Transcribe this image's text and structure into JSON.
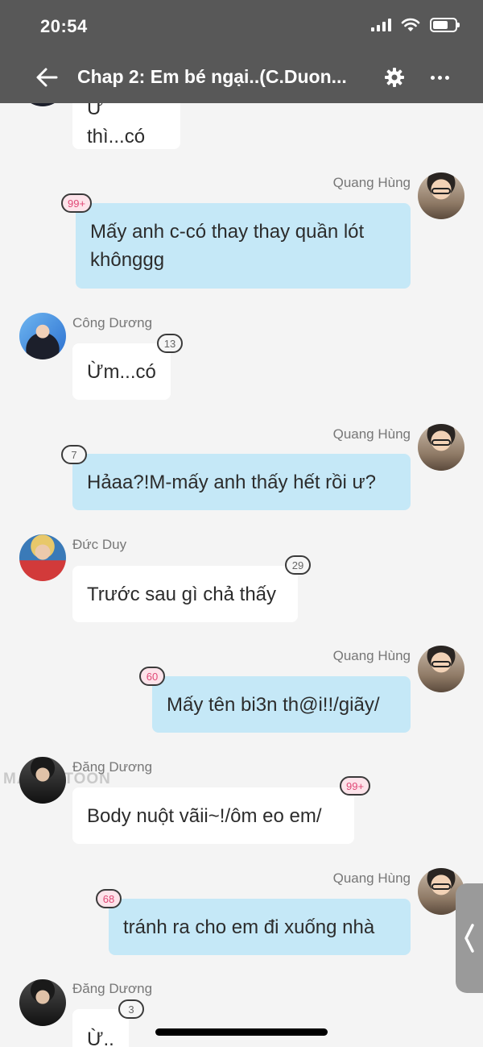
{
  "status_bar": {
    "time": "20:54"
  },
  "nav": {
    "title": "Chap 2: Em bé ngại..(C.Duon..."
  },
  "messages": [
    {
      "side": "left",
      "name": "",
      "text": "Ừ thì...có",
      "badge": ""
    },
    {
      "side": "right",
      "name": "Quang Hùng",
      "text": "Mấy anh c-có thay thay quần lót khônggg",
      "badge": "99+"
    },
    {
      "side": "left",
      "name": "Công Dương",
      "text": "Ừm...có",
      "badge": "13"
    },
    {
      "side": "right",
      "name": "Quang Hùng",
      "text": "Hảaa?!M-mấy anh thấy hết rồi ư?",
      "badge": "7"
    },
    {
      "side": "left",
      "name": "Đức Duy",
      "text": "Trước sau gì chả thấy",
      "badge": "29"
    },
    {
      "side": "right",
      "name": "Quang Hùng",
      "text": "Mấy tên bi3n th@i!!/giãy/",
      "badge": "60"
    },
    {
      "side": "left",
      "name": "Đăng Dương",
      "text": "Body nuột vãii~!/ôm eo em/",
      "badge": "99+"
    },
    {
      "side": "right",
      "name": "Quang Hùng",
      "text": "tránh ra cho em đi xuống nhà",
      "badge": "68"
    },
    {
      "side": "left",
      "name": "Đăng Dương",
      "text": "Ừ..",
      "badge": "3"
    }
  ],
  "watermark": "MANGATOON",
  "colors": {
    "header_bg": "#585858",
    "right_bubble": "#c5e8f7",
    "left_bubble": "#ffffff",
    "page_bg": "#f4f4f4",
    "badge_pink": "#e04876"
  }
}
